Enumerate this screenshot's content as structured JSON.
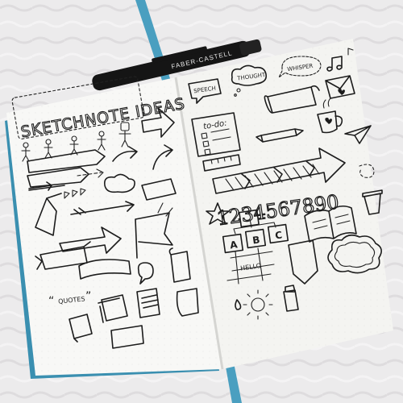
{
  "title": "SKETCHNOTE IDEAS",
  "speech_label": "SPEECH",
  "thought_label": "THOUGHT",
  "whisper_label": "WHISPER",
  "todo_label": "to-do:",
  "quotes_label": "QUOTES",
  "hello_label": "HELLO",
  "numbers": "1234567890",
  "letters": [
    "A",
    "B",
    "C"
  ],
  "pen_label": "FABER-CASTELL",
  "colors": {
    "fabric": "#ecebec",
    "paper": "#f8f8f6",
    "ink": "#1c1c1c",
    "ribbon": "#4a9fc0",
    "pen": "#151515"
  }
}
